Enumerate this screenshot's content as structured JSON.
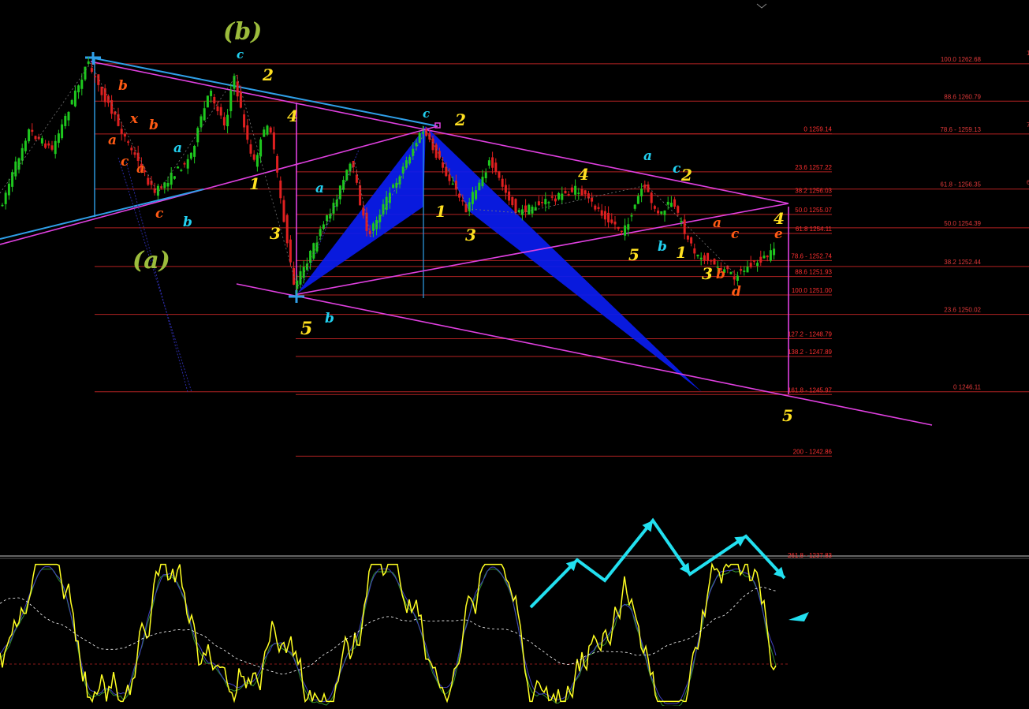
{
  "chart_data": {
    "type": "line",
    "title": "",
    "colors": {
      "background": "#000000",
      "fib_line": "#b32222",
      "fib_text": "#ff3030",
      "fib_text_right": "#e23a3a",
      "channel": "#e040e0",
      "trend_blue": "#2f9fe8",
      "pattern_fill": "#0a1cf0",
      "bull_candle": "#1ec81e",
      "bear_candle": "#e02020",
      "osc_yellow": "#ffff22",
      "osc_green": "#2e8b2e",
      "osc_blue": "#4040c0",
      "osc_signal": "#ffffff",
      "arrow_cyan": "#22e0f0",
      "label_yellow": "#ffe020",
      "label_orange": "#ff5a14",
      "label_cyan": "#22d0f0",
      "label_olive": "#9cbc3c",
      "separator": "#c8c8c8"
    },
    "fib_levels_left": [
      {
        "label": "100.0 1262.68",
        "price": 1262.68
      },
      {
        "label": "88.6 1260.79",
        "price": 1260.79
      },
      {
        "label": "78.6 - 1259.13",
        "price": 1259.13
      },
      {
        "label": "61.8 - 1256.35",
        "price": 1256.35
      },
      {
        "label": "50.0 1254.39",
        "price": 1254.39
      },
      {
        "label": "38.2 1252.44",
        "price": 1252.44
      },
      {
        "label": "23.6 1250.02",
        "price": 1250.02
      },
      {
        "label": "0 1246.11",
        "price": 1246.11
      }
    ],
    "fib_levels_mid": [
      {
        "label": "0 1259.14",
        "price": 1259.14
      },
      {
        "label": "23.6 1257.22",
        "price": 1257.22
      },
      {
        "label": "38.2 1256.03",
        "price": 1256.03
      },
      {
        "label": "50.0 1255.07",
        "price": 1255.07
      },
      {
        "label": "61.8 1254.11",
        "price": 1254.11
      },
      {
        "label": "78.6 - 1252.74",
        "price": 1252.74
      },
      {
        "label": "88.6 1251.93",
        "price": 1251.93
      },
      {
        "label": "100.0 1251.00",
        "price": 1251.0
      },
      {
        "label": "127.2 - 1248.79",
        "price": 1248.79
      },
      {
        "label": "138.2 - 1247.89",
        "price": 1247.89
      },
      {
        "label": "161.8 - 1245.97",
        "price": 1245.97
      },
      {
        "label": "200 - 1242.86",
        "price": 1242.86
      },
      {
        "label": "261.8 - 1237.83",
        "price": 1237.83
      }
    ],
    "right_edge_labels": [
      "1",
      "7",
      "6"
    ],
    "wave_labels": [
      {
        "text": "(b)",
        "color": "olive"
      },
      {
        "text": "(a)",
        "color": "olive"
      },
      {
        "text": "c",
        "color": "cyan"
      },
      {
        "text": "2",
        "color": "yellow"
      },
      {
        "text": "b",
        "color": "orange"
      },
      {
        "text": "x",
        "color": "orange"
      },
      {
        "text": "b",
        "color": "orange"
      },
      {
        "text": "a",
        "color": "orange"
      },
      {
        "text": "c",
        "color": "orange"
      },
      {
        "text": "a",
        "color": "orange"
      },
      {
        "text": "a",
        "color": "cyan"
      },
      {
        "text": "c",
        "color": "orange"
      },
      {
        "text": "b",
        "color": "cyan"
      },
      {
        "text": "4",
        "color": "yellow"
      },
      {
        "text": "1",
        "color": "yellow"
      },
      {
        "text": "3",
        "color": "yellow"
      },
      {
        "text": "5",
        "color": "yellow"
      },
      {
        "text": "b",
        "color": "cyan"
      },
      {
        "text": "a",
        "color": "cyan"
      },
      {
        "text": "c",
        "color": "cyan"
      },
      {
        "text": "2",
        "color": "yellow"
      },
      {
        "text": "1",
        "color": "yellow"
      },
      {
        "text": "3",
        "color": "yellow"
      },
      {
        "text": "4",
        "color": "yellow"
      },
      {
        "text": "5",
        "color": "yellow"
      },
      {
        "text": "a",
        "color": "cyan"
      },
      {
        "text": "c",
        "color": "cyan"
      },
      {
        "text": "2",
        "color": "yellow"
      },
      {
        "text": "b",
        "color": "cyan"
      },
      {
        "text": "1",
        "color": "yellow"
      },
      {
        "text": "a",
        "color": "orange"
      },
      {
        "text": "c",
        "color": "orange"
      },
      {
        "text": "3",
        "color": "yellow"
      },
      {
        "text": "b",
        "color": "orange"
      },
      {
        "text": "d",
        "color": "orange"
      },
      {
        "text": "4",
        "color": "yellow"
      },
      {
        "text": "e",
        "color": "orange"
      },
      {
        "text": "5",
        "color": "yellow"
      }
    ]
  }
}
